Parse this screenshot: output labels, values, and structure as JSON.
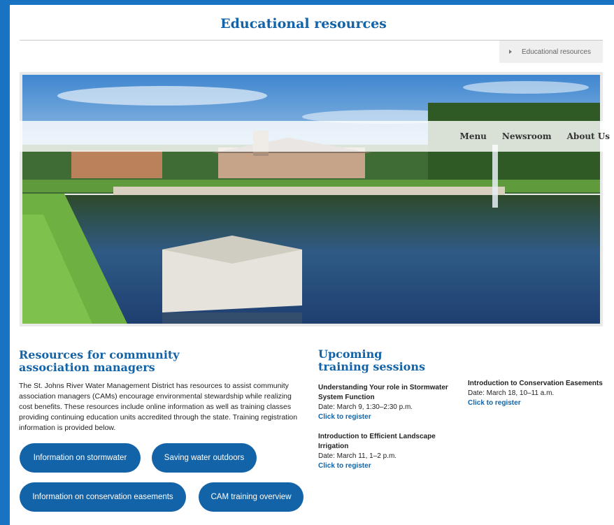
{
  "header": {
    "title": "Educational resources",
    "breadcrumb": "Educational resources"
  },
  "nav": {
    "items": [
      "Menu",
      "Newsroom",
      "About Us"
    ]
  },
  "resources": {
    "heading": "Resources for community association managers",
    "intro": "The St. Johns River Water Management District has resources to assist community association managers (CAMs) encourage environmental stewardship while realizing cost benefits. These resources include online information as well as training classes providing continuing education units accredited through the state. Training registration information is provided below.",
    "buttons": [
      "Information on stormwater",
      "Saving water outdoors",
      "Information on conservation easements",
      "CAM training overview"
    ]
  },
  "training": {
    "heading": "Upcoming training sessions",
    "events": [
      {
        "title": "Understanding Your role in Stormwater System Function",
        "date": "Date: March 9, 1:30–2:30 p.m.",
        "link": "Click to register"
      },
      {
        "title": "Introduction to Efficient Landscape Irrigation",
        "date": "Date: March 11, 1–2 p.m.",
        "link": "Click to register"
      },
      {
        "title": "Introduction to Conservation Easements",
        "date": "Date: March 18, 10–11 a.m.",
        "link": "Click to register"
      }
    ]
  },
  "colors": {
    "brand_blue": "#1263a8",
    "frame_blue": "#1a73c2"
  }
}
